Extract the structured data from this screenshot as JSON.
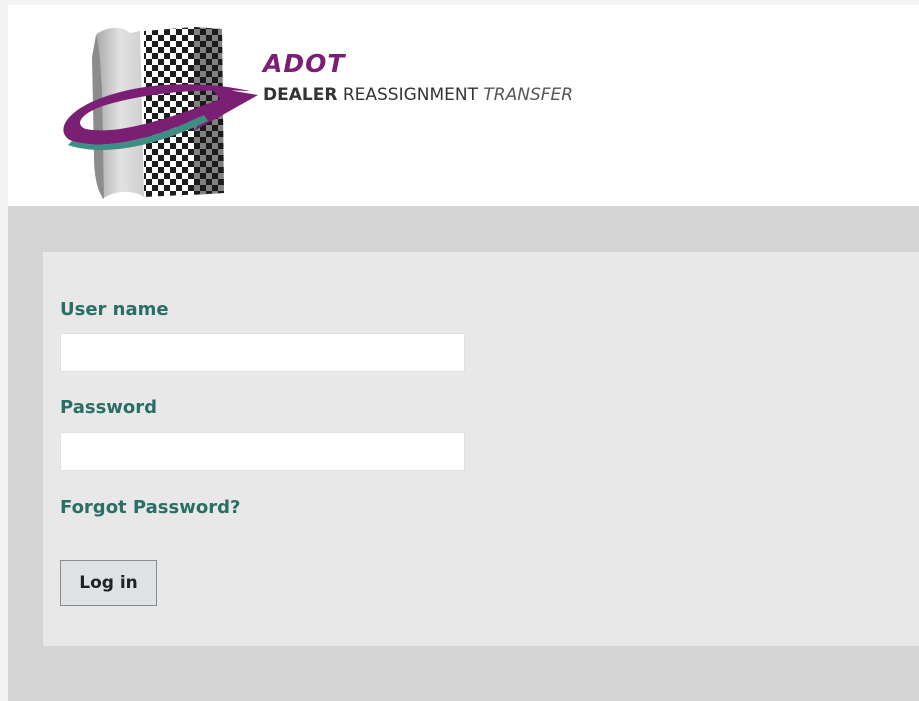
{
  "brand": {
    "acronym": "ADOT",
    "line_bold": "DEALER",
    "line_mid": "REASSIGNMENT",
    "line_italic": "TRANSFER",
    "colors": {
      "purple": "#7b1f74",
      "teal": "#3e8e84",
      "accent_text": "#2a6e66"
    }
  },
  "login_form": {
    "username_label": "User name",
    "username_value": "",
    "password_label": "Password",
    "password_value": "",
    "forgot_link": "Forgot Password?",
    "submit_label": "Log in"
  }
}
